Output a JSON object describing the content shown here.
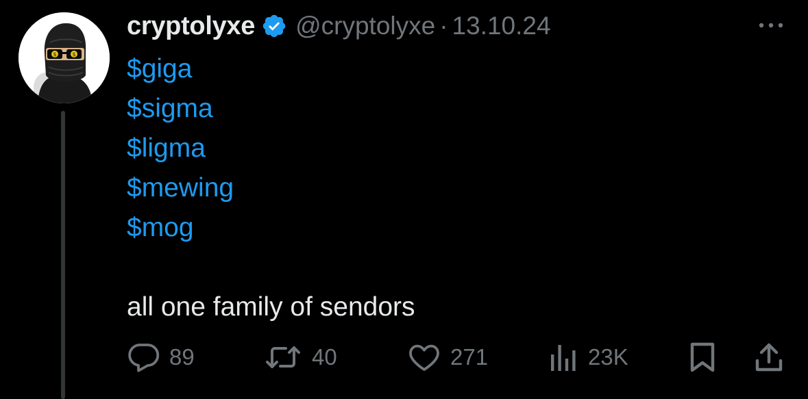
{
  "author": {
    "display_name": "cryptolyxe",
    "handle": "@cryptolyxe",
    "separator": "·",
    "date": "13.10.24",
    "verified": true,
    "avatar_icon": "masked-person-avatar",
    "verified_color": "#1d9bf0"
  },
  "tweet": {
    "cashtags": [
      "$giga",
      "$sigma",
      "$ligma",
      "$mewing",
      "$mog"
    ],
    "text": "all one family of sendors"
  },
  "actions": {
    "replies": "89",
    "reposts": "40",
    "likes": "271",
    "views": "23K"
  },
  "colors": {
    "background": "#000000",
    "primary_text": "#e7e9ea",
    "secondary_text": "#71767b",
    "link": "#1d9bf0"
  }
}
